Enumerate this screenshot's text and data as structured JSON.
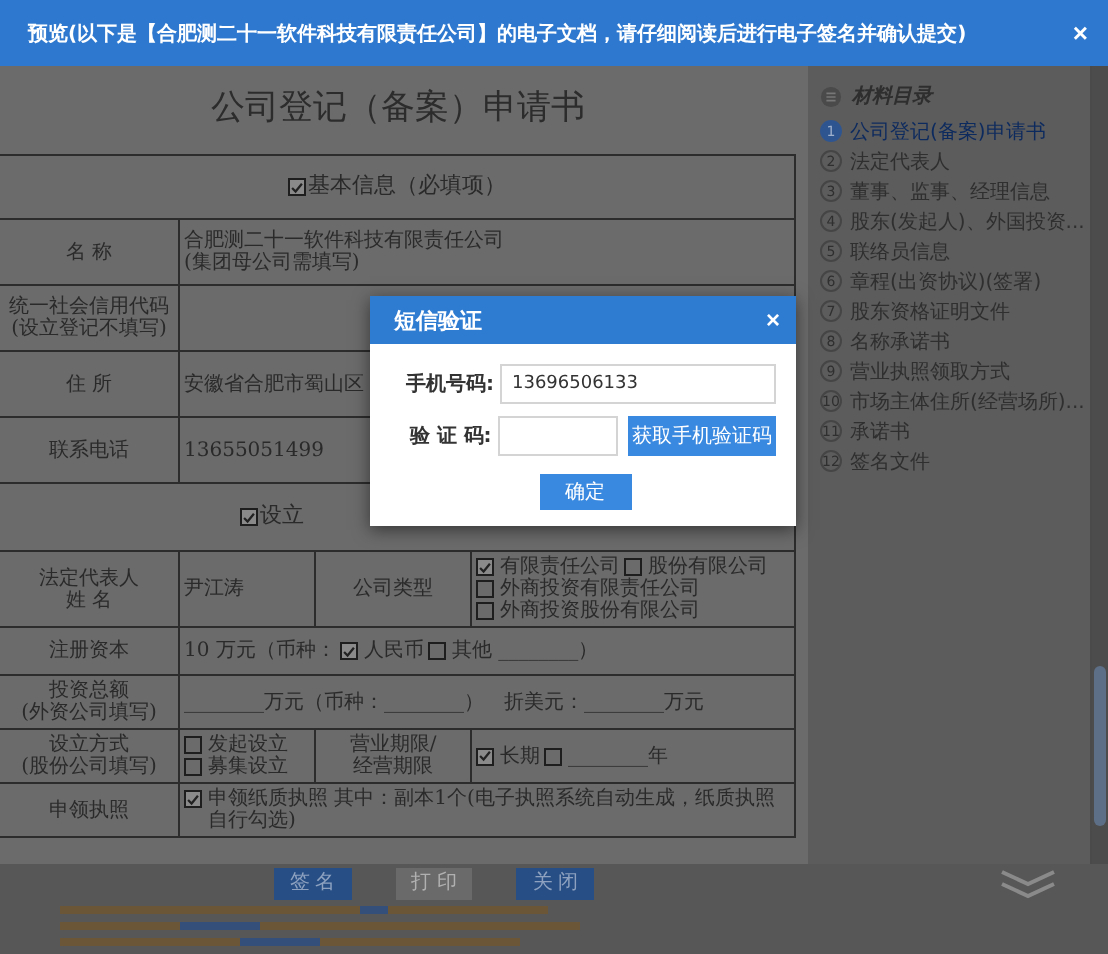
{
  "header": {
    "title": "预览(以下是【合肥测二十一软件科技有限责任公司】的电子文档，请仔细阅读后进行电子签名并确认提交)",
    "close": "×"
  },
  "document": {
    "title": "公司登记（备案）申请书",
    "sections": [
      {
        "heading": "基本信息（必填项）",
        "checked": true,
        "rows": [
          {
            "cells": [
              {
                "kind": "label",
                "lines": [
                  "名 称"
                ]
              },
              {
                "kind": "value",
                "lines": [
                  "合肥测二十一软件科技有限责任公司",
                  "(集团母公司需填写)"
                ]
              }
            ]
          },
          {
            "cells": [
              {
                "kind": "label",
                "lines": [
                  "统一社会信用代码",
                  "(设立登记不填写)"
                ]
              },
              {
                "kind": "value"
              }
            ]
          },
          {
            "cells": [
              {
                "kind": "label",
                "lines": [
                  "住 所"
                ]
              },
              {
                "kind": "value",
                "lines": [
                  "安徽省合肥市蜀山区"
                ]
              }
            ]
          },
          {
            "cells": [
              {
                "kind": "label",
                "lines": [
                  "联系电话"
                ]
              },
              {
                "kind": "value",
                "lines": [
                  "13655051499"
                ]
              }
            ]
          }
        ]
      },
      {
        "heading": "设立",
        "checked": true,
        "rows": [
          {
            "cells": [
              {
                "kind": "label",
                "lines": [
                  "法定代表人",
                  "姓 名"
                ]
              },
              {
                "kind": "value",
                "lines": [
                  "尹江涛"
                ]
              },
              {
                "kind": "label",
                "lines": [
                  "公司类型"
                ]
              },
              {
                "kind": "value",
                "lines": [
                  [
                    {
                      "kind": "box",
                      "checked": true
                    },
                    {
                      "kind": "text",
                      "text": "有限责任公司"
                    },
                    {
                      "kind": "box",
                      "checked": false
                    },
                    {
                      "kind": "text",
                      "text": "股份有限公司"
                    }
                  ],
                  [
                    {
                      "kind": "box",
                      "checked": false
                    },
                    {
                      "kind": "text",
                      "text": "外商投资有限责任公司"
                    }
                  ],
                  [
                    {
                      "kind": "box",
                      "checked": false
                    },
                    {
                      "kind": "text",
                      "text": "外商投资股份有限公司"
                    }
                  ]
                ]
              }
            ]
          },
          {
            "cells": [
              {
                "kind": "label",
                "lines": [
                  "注册资本"
                ]
              },
              {
                "kind": "value",
                "lines": [
                  [
                    {
                      "kind": "text",
                      "text": "10 万元（币种："
                    },
                    {
                      "kind": "box",
                      "checked": true
                    },
                    {
                      "kind": "text",
                      "text": "人民币"
                    },
                    {
                      "kind": "box",
                      "checked": false
                    },
                    {
                      "kind": "text",
                      "text": "其他 ________）"
                    }
                  ]
                ]
              }
            ]
          },
          {
            "cells": [
              {
                "kind": "label",
                "lines": [
                  "投资总额",
                  "(外资公司填写)"
                ]
              },
              {
                "kind": "value",
                "lines": [
                  "________万元（币种：________）　折美元：________万元"
                ]
              }
            ]
          },
          {
            "cells": [
              {
                "kind": "label",
                "lines": [
                  "设立方式",
                  "(股份公司填写)"
                ]
              },
              {
                "kind": "value",
                "lines": [
                  [
                    {
                      "kind": "box",
                      "checked": false
                    },
                    {
                      "kind": "text",
                      "text": "发起设立"
                    }
                  ],
                  [
                    {
                      "kind": "box",
                      "checked": false
                    },
                    {
                      "kind": "text",
                      "text": "募集设立"
                    }
                  ]
                ]
              },
              {
                "kind": "label",
                "lines": [
                  "营业期限/",
                  "经营期限"
                ]
              },
              {
                "kind": "value",
                "lines": [
                  [
                    {
                      "kind": "box",
                      "checked": true
                    },
                    {
                      "kind": "text",
                      "text": "长期"
                    },
                    {
                      "kind": "box",
                      "checked": false
                    },
                    {
                      "kind": "text",
                      "text": "________年"
                    }
                  ]
                ]
              }
            ]
          },
          {
            "cells": [
              {
                "kind": "label",
                "lines": [
                  "申领执照"
                ]
              },
              {
                "kind": "value",
                "lines": [
                  [
                    {
                      "kind": "box",
                      "checked": true
                    },
                    {
                      "kind": "text",
                      "text": "申领纸质执照 其中：副本1个(电子执照系统自动生成，纸质执照自行勾选)"
                    }
                  ]
                ]
              }
            ]
          }
        ]
      }
    ]
  },
  "buttons": [
    {
      "label": "签 名",
      "disabled": false
    },
    {
      "label": "打 印",
      "disabled": true
    },
    {
      "label": "关 闭",
      "disabled": false
    }
  ],
  "sidebar": {
    "title": "材料目录",
    "items": [
      {
        "number": "1",
        "label": "公司登记(备案)申请书",
        "selected": true
      },
      {
        "number": "2",
        "label": "法定代表人",
        "selected": false
      },
      {
        "number": "3",
        "label": "董事、监事、经理信息",
        "selected": false
      },
      {
        "number": "4",
        "label": "股东(发起人)、外国投资...",
        "selected": false
      },
      {
        "number": "5",
        "label": "联络员信息",
        "selected": false
      },
      {
        "number": "6",
        "label": "章程(出资协议)(签署)",
        "selected": false
      },
      {
        "number": "7",
        "label": "股东资格证明文件",
        "selected": false
      },
      {
        "number": "8",
        "label": "名称承诺书",
        "selected": false
      },
      {
        "number": "9",
        "label": "营业执照领取方式",
        "selected": false
      },
      {
        "number": "10",
        "label": "市场主体住所(经营场所)...",
        "selected": false
      },
      {
        "number": "11",
        "label": "承诺书",
        "selected": false
      },
      {
        "number": "12",
        "label": "签名文件",
        "selected": false
      }
    ]
  },
  "dialog": {
    "title": "短信验证",
    "close": "×",
    "phone_label": "手机号码:",
    "phone_value": "13696506133",
    "code_label": "验 证 码:",
    "code_button": "获取手机验证码",
    "confirm": "确定"
  }
}
